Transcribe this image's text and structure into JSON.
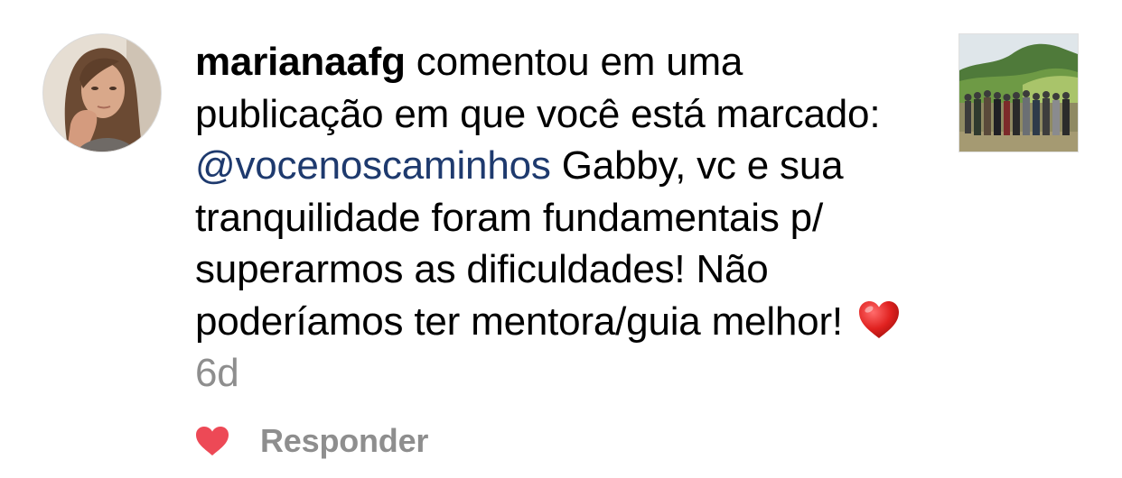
{
  "notification": {
    "username": "marianaafg",
    "action_text": "comentou em uma publicação em que você está marcado:",
    "mention": "@vocenoscaminhos",
    "comment_body": "Gabby, vc e sua tranquilidade foram fundamentais p/ superarmos as dificuldades! Não poderíamos ter mentora/guia melhor!",
    "emoji": "red-heart-emoji",
    "timestamp": "6d"
  },
  "actions": {
    "like_icon": "heart-icon",
    "reply_label": "Responder"
  },
  "colors": {
    "mention": "#1e3a6e",
    "muted": "#8e8e8e",
    "heart": "#ed4956",
    "text": "#000000"
  }
}
